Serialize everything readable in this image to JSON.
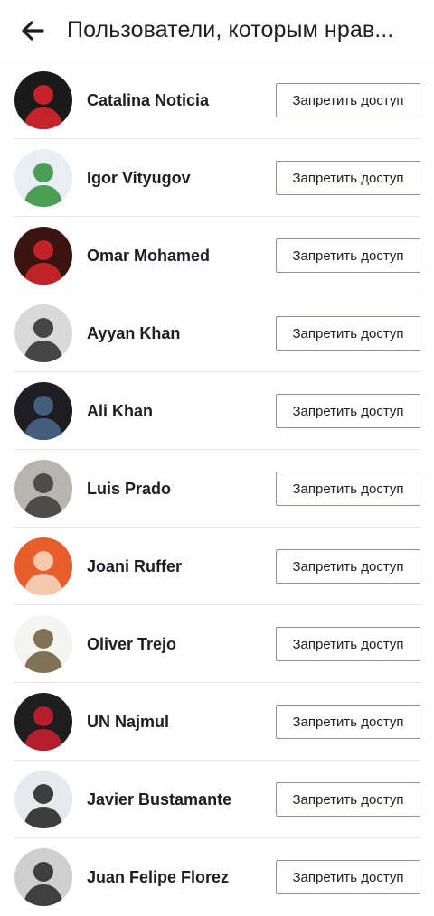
{
  "header": {
    "title": "Пользователи, которым нрав..."
  },
  "users": [
    {
      "name": "Catalina Noticia",
      "button": "Запретить доступ",
      "avatar_bg": "#1a1a1a",
      "avatar_accent": "#e4242f"
    },
    {
      "name": "Igor Vityugov",
      "button": "Запретить доступ",
      "avatar_bg": "#e8eef4",
      "avatar_accent": "#2f8f3a"
    },
    {
      "name": "Omar Mohamed",
      "button": "Запретить доступ",
      "avatar_bg": "#3a1410",
      "avatar_accent": "#d8262c"
    },
    {
      "name": "Ayyan Khan",
      "button": "Запретить доступ",
      "avatar_bg": "#d9d9d9",
      "avatar_accent": "#2a2a2a"
    },
    {
      "name": "Ali Khan",
      "button": "Запретить доступ",
      "avatar_bg": "#1e1e22",
      "avatar_accent": "#4a6a8a"
    },
    {
      "name": "Luis Prado",
      "button": "Запретить доступ",
      "avatar_bg": "#b8b4ae",
      "avatar_accent": "#3a3a3a"
    },
    {
      "name": "Joani Ruffer",
      "button": "Запретить доступ",
      "avatar_bg": "#e85d2c",
      "avatar_accent": "#f7d9c4"
    },
    {
      "name": "Oliver Trejo",
      "button": "Запретить доступ",
      "avatar_bg": "#f4f4f2",
      "avatar_accent": "#6b5a3a"
    },
    {
      "name": "UN Najmul",
      "button": "Запретить доступ",
      "avatar_bg": "#1e1e1e",
      "avatar_accent": "#d01f2f"
    },
    {
      "name": "Javier Bustamante",
      "button": "Запретить доступ",
      "avatar_bg": "#e6e9ed",
      "avatar_accent": "#1e1e1e"
    },
    {
      "name": "Juan Felipe Florez",
      "button": "Запретить доступ",
      "avatar_bg": "#cfcfcf",
      "avatar_accent": "#262626"
    }
  ],
  "colors": {
    "text": "#1c1e21",
    "divider": "#e4e6eb",
    "button_border": "#8d949e"
  }
}
